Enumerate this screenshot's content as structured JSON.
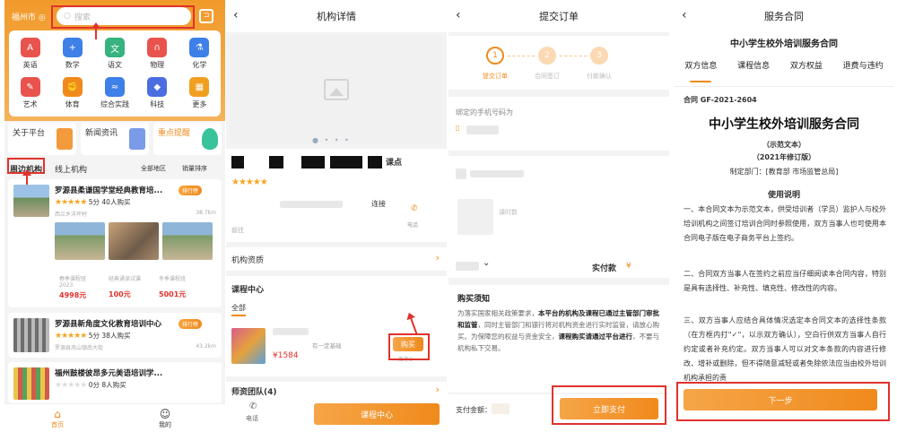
{
  "panel1": {
    "city": "福州市",
    "search_placeholder": "搜索",
    "subjects": [
      {
        "label": "英语",
        "icon": "abc-icon",
        "color": "#e9534d"
      },
      {
        "label": "数学",
        "icon": "math-icon",
        "color": "#3f7fe8"
      },
      {
        "label": "语文",
        "icon": "chinese-icon",
        "color": "#36b37e"
      },
      {
        "label": "物理",
        "icon": "magnet-icon",
        "color": "#e9534d"
      },
      {
        "label": "化学",
        "icon": "flask-icon",
        "color": "#3f7fe8"
      },
      {
        "label": "艺术",
        "icon": "palette-icon",
        "color": "#e9534d"
      },
      {
        "label": "体育",
        "icon": "arm-icon",
        "color": "#f08a1c"
      },
      {
        "label": "综合实践",
        "icon": "wave-icon",
        "color": "#3f7fe8"
      },
      {
        "label": "科技",
        "icon": "cube-icon",
        "color": "#4a6ee0"
      },
      {
        "label": "更多",
        "icon": "grid-icon",
        "color": "#f0a020"
      }
    ],
    "quick": [
      {
        "label": "关于平台",
        "color": "#f39a3d"
      },
      {
        "label": "新闻资讯",
        "color": "#7a9be8"
      },
      {
        "label": "重点提醒",
        "color": "#39c39b"
      }
    ],
    "tabs": {
      "nearby": "周边机构",
      "online": "线上机构",
      "region": "全部地区",
      "sort": "销量排序"
    },
    "institutions": [
      {
        "name": "罗源县柔谦国学堂经典教育培...",
        "tag": "排行榜",
        "rating": "5分",
        "sold": "40人购买",
        "address": "西兰乡洋坪村",
        "distance": "38.7km",
        "courses": [
          {
            "name": "春季课程班",
            "year": "2023",
            "price": "4998元"
          },
          {
            "name": "经典诵读试课",
            "year": "",
            "price": "100元"
          },
          {
            "name": "冬季课程班",
            "year": "",
            "price": "5001元"
          }
        ]
      },
      {
        "name": "罗源县新角度文化教育培训中心",
        "tag": "排行榜",
        "rating": "5分",
        "sold": "38人购买",
        "address": "罗源县凤山镇南大街",
        "distance": "43.2km"
      },
      {
        "name": "福州鼓楼彼昂多元美语培训学...",
        "rating": "0分",
        "sold": "8人购买"
      }
    ],
    "tabbar": {
      "home": "首页",
      "mine": "我的"
    }
  },
  "panel2": {
    "title": "机构详情",
    "name_suffix": "课点",
    "contact_word": "连接",
    "call_label": "电话",
    "goto": "前往",
    "qualification": "机构资质",
    "course_center": "课程中心",
    "all": "全部",
    "course_price": "¥1584",
    "course_note": "有一定基础",
    "buy": "购买",
    "buy_note": "库存3",
    "teachers": "师资团队(4)",
    "bottom_phone": "电话",
    "bottom_btn": "课程中心"
  },
  "panel3": {
    "title": "提交订单",
    "steps": [
      {
        "num": "1",
        "label": "提交订单"
      },
      {
        "num": "2",
        "label": "合同签订"
      },
      {
        "num": "3",
        "label": "付款确认"
      }
    ],
    "phone_label": "绑定的手机号码为",
    "course_tag": "课时数",
    "paid_label": "实付款",
    "paid_currency": "¥",
    "notice_title": "购买须知",
    "notice_p1": "为落实国家相关政策要求，",
    "notice_b1": "本平台的机构及课程已通过主管部门审批和监管",
    "notice_p2": "，同时主管部门和银行将对机构资金进行实时监管，请放心购买。为保障您的权益与资金安全，",
    "notice_b2": "课程购买请通过平台进行",
    "notice_p3": "，不要与机构私下交易。",
    "amount_label": "支付金额：",
    "pay_btn": "立即支付"
  },
  "panel4": {
    "title": "服务合同",
    "subtitle": "中小学生校外培训服务合同",
    "tabs": [
      "双方信息",
      "课程信息",
      "双方权益",
      "退费与违约"
    ],
    "contract_no": "合同 GF-2021-2604",
    "big_title": "中小学生校外培训服务合同",
    "sample": "（示范文本）",
    "edition": "（2021年修订版）",
    "maker": "制定部门：[教育部 市场监管总局]",
    "usage_title": "使用说明",
    "para1": "一、本合同文本为示范文本，供受培训者（学员）监护人与校外培训机构之间签订培训合同时参照使用，双方当事人也可使用本合同电子版在电子商务平台上签约。",
    "para2": "二、合同双方当事人在签约之前应当仔细阅读本合同内容，特别是具有选择性、补充性、填充性、修改性的内容。",
    "para3": "三、双方当事人应结合具体情况选定本合同文本的选择性条款（在方框内打\"✓\"，以示双方确认），空白行供双方当事人自行约定或者补充约定。双方当事人可以对文本条款的内容进行修改、增补或删除，但不得随意减轻或者免除依法应当由校外培训机构承担的责",
    "next_btn": "下一步"
  }
}
